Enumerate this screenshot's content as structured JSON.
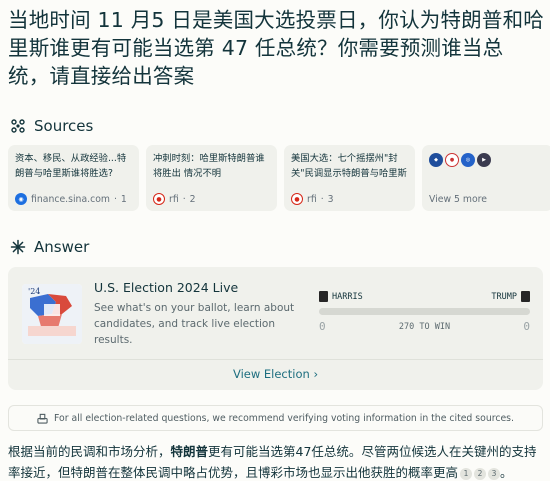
{
  "question": "当地时间 11 月5 日是美国大选投票日，你认为特朗普和哈里斯谁更有可能当选第 47 任总统？你需要预测谁当总统，请直接给出答案",
  "sources": {
    "heading": "Sources",
    "items": [
      {
        "title": "资本、移民、从政经验...特朗普与哈里斯谁将胜选?",
        "site": "finance.sina.com",
        "index": "1",
        "favicon": "sina-icon"
      },
      {
        "title": "冲刺时刻：哈里斯特朗普谁将胜出 情况不明",
        "site": "rfi",
        "index": "2",
        "favicon": "rfi-icon"
      },
      {
        "title": "美国大选：七个摇摆州\"封关\"民调显示特朗普与哈里斯仍势均力敌",
        "site": "rfi",
        "index": "3",
        "favicon": "rfi-icon"
      }
    ],
    "more_label": "View 5 more"
  },
  "answer": {
    "heading": "Answer",
    "election": {
      "title": "U.S. Election 2024 Live",
      "description": "See what's on your ballot, learn about candidates, and track live election results.",
      "left_candidate": "HARRIS",
      "right_candidate": "TRUMP",
      "left_votes": "0",
      "right_votes": "0",
      "win_label": "270 TO WIN",
      "link_label": "View Election ›"
    },
    "notice": "For all election-related questions, we recommend verifying voting information in the cited sources.",
    "text_before": "根据当前的民调和市场分析，",
    "text_bold": "特朗普",
    "text_after": "更有可能当选第47任总统。尽管两位候选人在关键州的支持率接近，但特朗普在整体民调中略占优势，且博彩市场也显示出他获胜的概率更高",
    "citations": [
      "1",
      "2",
      "3"
    ],
    "text_end": "。"
  },
  "colors": {
    "background": "#fcfcf9",
    "card": "#f0f1ec",
    "accent": "#1d6e7f",
    "text": "#13343b"
  }
}
